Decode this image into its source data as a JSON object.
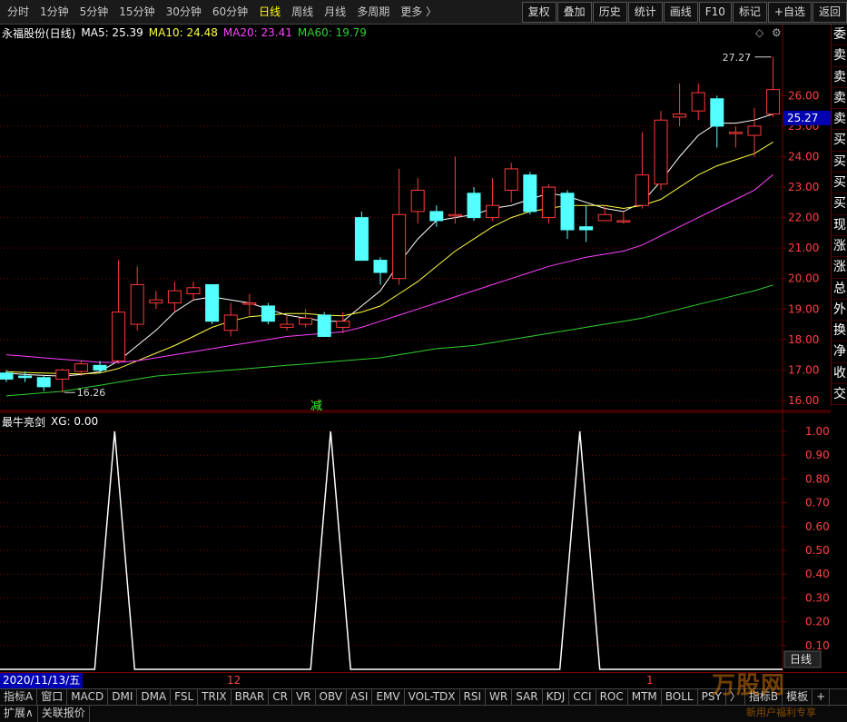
{
  "toolbar": {
    "periods": [
      {
        "label": "分时",
        "active": false
      },
      {
        "label": "1分钟",
        "active": false
      },
      {
        "label": "5分钟",
        "active": false
      },
      {
        "label": "15分钟",
        "active": false
      },
      {
        "label": "30分钟",
        "active": false
      },
      {
        "label": "60分钟",
        "active": false
      },
      {
        "label": "日线",
        "active": true
      },
      {
        "label": "周线",
        "active": false
      },
      {
        "label": "月线",
        "active": false
      },
      {
        "label": "多周期",
        "active": false
      },
      {
        "label": "更多 〉",
        "active": false
      }
    ],
    "buttons": [
      "复权",
      "叠加",
      "历史",
      "统计",
      "画线",
      "F10",
      "标记",
      "+自选",
      "返回"
    ]
  },
  "main_legend": {
    "stock": "永福股份(日线)",
    "ma5": "MA5: 25.39",
    "ma10": "MA10: 24.48",
    "ma20": "MA20: 23.41",
    "ma60": "MA60: 19.79"
  },
  "colors": {
    "up": "#ff3a3a",
    "down": "#54ffff",
    "ma5": "#ffffff",
    "ma10": "#ffff40",
    "ma20": "#ff40ff",
    "ma60": "#30d030",
    "grid": "#7a0000",
    "axis_text": "#ff4040",
    "price_tag_bg": "#0000b0"
  },
  "chart_data": [
    {
      "type": "candlestick",
      "title": "永福股份(日线)",
      "ylim": [
        15.7,
        27.8
      ],
      "yticks": [
        16.0,
        17.0,
        18.0,
        19.0,
        20.0,
        21.0,
        22.0,
        23.0,
        24.0,
        25.0,
        26.0
      ],
      "current_price": "25.27",
      "high_label": "27.27",
      "low_label": "16.26",
      "bottom_marker": "减",
      "candles": [
        [
          16.9,
          16.7,
          17.0,
          16.6
        ],
        [
          16.8,
          16.75,
          16.95,
          16.6
        ],
        [
          16.75,
          16.45,
          16.8,
          16.3
        ],
        [
          16.7,
          17.0,
          17.05,
          16.26
        ],
        [
          16.95,
          17.2,
          17.3,
          16.8
        ],
        [
          17.15,
          17.0,
          17.3,
          16.9
        ],
        [
          17.3,
          18.9,
          20.6,
          17.2
        ],
        [
          18.5,
          19.8,
          20.4,
          18.3
        ],
        [
          19.2,
          19.3,
          19.6,
          19.0
        ],
        [
          19.2,
          19.6,
          19.9,
          18.9
        ],
        [
          19.5,
          19.7,
          19.9,
          19.3
        ],
        [
          19.8,
          18.6,
          19.8,
          18.5
        ],
        [
          18.3,
          18.8,
          19.2,
          18.1
        ],
        [
          19.2,
          19.2,
          19.5,
          18.8
        ],
        [
          19.1,
          18.6,
          19.2,
          18.5
        ],
        [
          18.4,
          18.5,
          18.8,
          18.3
        ],
        [
          18.5,
          18.7,
          19.0,
          18.4
        ],
        [
          18.8,
          18.1,
          18.9,
          18.1
        ],
        [
          18.4,
          18.6,
          18.9,
          18.2
        ],
        [
          22.0,
          20.6,
          22.2,
          20.6
        ],
        [
          20.6,
          20.2,
          20.7,
          19.8
        ],
        [
          20.0,
          22.1,
          23.6,
          19.8
        ],
        [
          22.2,
          22.9,
          23.3,
          21.8
        ],
        [
          22.2,
          21.9,
          22.4,
          21.7
        ],
        [
          22.1,
          22.1,
          24.0,
          21.8
        ],
        [
          22.8,
          22.0,
          23.0,
          21.9
        ],
        [
          22.0,
          22.4,
          23.3,
          21.9
        ],
        [
          22.9,
          23.6,
          23.8,
          22.5
        ],
        [
          23.4,
          22.2,
          23.5,
          22.1
        ],
        [
          22.0,
          23.0,
          23.1,
          21.8
        ],
        [
          22.8,
          21.6,
          22.9,
          21.3
        ],
        [
          21.7,
          21.6,
          22.4,
          21.2
        ],
        [
          21.9,
          22.1,
          22.4,
          21.9
        ],
        [
          21.9,
          21.9,
          22.2,
          21.8
        ],
        [
          22.4,
          23.4,
          24.8,
          22.3
        ],
        [
          23.1,
          25.2,
          25.5,
          22.9
        ],
        [
          25.3,
          25.4,
          26.4,
          25.0
        ],
        [
          25.5,
          26.1,
          26.4,
          25.2
        ],
        [
          25.9,
          25.0,
          26.0,
          24.3
        ],
        [
          24.8,
          24.8,
          25.0,
          24.3
        ],
        [
          24.7,
          25.0,
          25.6,
          24.0
        ],
        [
          25.4,
          26.2,
          27.27,
          25.3
        ]
      ],
      "ma": {
        "MA5": [
          16.9,
          16.85,
          16.82,
          16.8,
          16.85,
          16.95,
          17.3,
          17.8,
          18.3,
          18.9,
          19.3,
          19.4,
          19.3,
          19.2,
          19.0,
          18.8,
          18.7,
          18.6,
          18.6,
          19.1,
          19.6,
          20.5,
          21.3,
          21.9,
          22.0,
          22.1,
          22.3,
          22.4,
          22.6,
          22.8,
          22.7,
          22.5,
          22.3,
          22.2,
          22.5,
          23.2,
          24.0,
          24.7,
          25.1,
          25.1,
          25.2,
          25.4
        ],
        "MA10": [
          16.95,
          16.92,
          16.9,
          16.88,
          16.87,
          16.9,
          17.05,
          17.3,
          17.55,
          17.8,
          18.1,
          18.4,
          18.6,
          18.75,
          18.8,
          18.85,
          18.85,
          18.8,
          18.78,
          18.9,
          19.1,
          19.5,
          19.9,
          20.4,
          20.9,
          21.3,
          21.7,
          22.0,
          22.2,
          22.3,
          22.4,
          22.4,
          22.4,
          22.3,
          22.4,
          22.6,
          23.0,
          23.4,
          23.7,
          23.9,
          24.1,
          24.48
        ],
        "MA20": [
          17.5,
          17.45,
          17.4,
          17.35,
          17.3,
          17.25,
          17.25,
          17.3,
          17.4,
          17.5,
          17.6,
          17.7,
          17.8,
          17.9,
          18.0,
          18.1,
          18.15,
          18.2,
          18.25,
          18.4,
          18.6,
          18.8,
          19.0,
          19.2,
          19.4,
          19.6,
          19.8,
          20.0,
          20.2,
          20.4,
          20.55,
          20.7,
          20.8,
          20.9,
          21.1,
          21.4,
          21.7,
          22.0,
          22.3,
          22.6,
          22.9,
          23.41
        ],
        "MA60": [
          16.15,
          16.2,
          16.25,
          16.3,
          16.4,
          16.5,
          16.6,
          16.7,
          16.8,
          16.85,
          16.9,
          16.95,
          17.0,
          17.05,
          17.1,
          17.15,
          17.2,
          17.25,
          17.3,
          17.35,
          17.4,
          17.5,
          17.6,
          17.7,
          17.75,
          17.8,
          17.9,
          18.0,
          18.1,
          18.2,
          18.3,
          18.4,
          18.5,
          18.6,
          18.7,
          18.85,
          19.0,
          19.15,
          19.3,
          19.45,
          19.6,
          19.79
        ]
      }
    },
    {
      "type": "line",
      "title": "最牛亮剑",
      "series": [
        {
          "name": "XG",
          "values": [
            0,
            0,
            0,
            0,
            0,
            0,
            0,
            0,
            0,
            0,
            0,
            1,
            0,
            0,
            0,
            0,
            0,
            0,
            0,
            0,
            0,
            0,
            0,
            0,
            0,
            0,
            0,
            0,
            0,
            0,
            0,
            0,
            0,
            0,
            0,
            0,
            0,
            0,
            0,
            0,
            0,
            0,
            0,
            0,
            0,
            0,
            0,
            0,
            0,
            0,
            0,
            0,
            0,
            0,
            0,
            0,
            0,
            0,
            0,
            0,
            0,
            0,
            0,
            0,
            0,
            0,
            0,
            0,
            0,
            0,
            0,
            0,
            0,
            0,
            0,
            0,
            0,
            0,
            0,
            0,
            0,
            0,
            0,
            0,
            0,
            0,
            0,
            0,
            0,
            0,
            0,
            0,
            0,
            0,
            0,
            0,
            0,
            0,
            0,
            0,
            0,
            0,
            0,
            0,
            0,
            0,
            0,
            0,
            0,
            0,
            0,
            0,
            0,
            0,
            0,
            0,
            0,
            0,
            0,
            0,
            0,
            0,
            0,
            0,
            0,
            0,
            0,
            0,
            0,
            0,
            0,
            0,
            0,
            0,
            0,
            0,
            0,
            0,
            0,
            0,
            0,
            0,
            0,
            0,
            0,
            0,
            0,
            0,
            0,
            0,
            0,
            0,
            0,
            0,
            0,
            0,
            0,
            0,
            0,
            0,
            0,
            0,
            0,
            0,
            0,
            0,
            0,
            0,
            0,
            0,
            0,
            0,
            0,
            0,
            0,
            0,
            0,
            0,
            0,
            0,
            0,
            0,
            0,
            0,
            0,
            0,
            0,
            0,
            0,
            0,
            0,
            0,
            0,
            0,
            0,
            0,
            0,
            0,
            0,
            0,
            0,
            0,
            0,
            0,
            0,
            0,
            0,
            0,
            0
          ]
        }
      ],
      "peaks_at_candle": [
        12.3,
        36.9
      ],
      "legend": "最牛亮剑",
      "legend_value": "XG: 0.00",
      "ylim": [
        0,
        1.0
      ],
      "yticks": [
        "1.00",
        "0.90",
        "0.80",
        "0.70",
        "0.60",
        "0.50",
        "0.40",
        "0.30",
        "0.20",
        "0.10"
      ]
    }
  ],
  "indicator_peaks": [
    0.138,
    0.398,
    0.698
  ],
  "sidebar": [
    "委",
    "卖",
    "卖",
    "卖",
    "卖",
    "买",
    "买",
    "买",
    "买",
    "现",
    "涨",
    "涨",
    "总",
    "外",
    "换",
    "净",
    "收",
    "交"
  ],
  "date_row": {
    "first": "2020/11/13/五",
    "marks": [
      "12",
      "1"
    ]
  },
  "indicator_tabs": [
    "指标A",
    "窗口",
    "MACD",
    "DMI",
    "DMA",
    "FSL",
    "TRIX",
    "BRAR",
    "CR",
    "VR",
    "OBV",
    "ASI",
    "EMV",
    "VOL-TDX",
    "RSI",
    "WR",
    "SAR",
    "KDJ",
    "CCI",
    "ROC",
    "MTM",
    "BOLL",
    "PSY",
    "〉",
    "指标B",
    "模板",
    "+"
  ],
  "bottom_tabs": [
    "扩展∧",
    "关联报价"
  ],
  "watermark": {
    "big": "万股网",
    "small": "新用户福利专享"
  },
  "ind_right_label": "日线"
}
